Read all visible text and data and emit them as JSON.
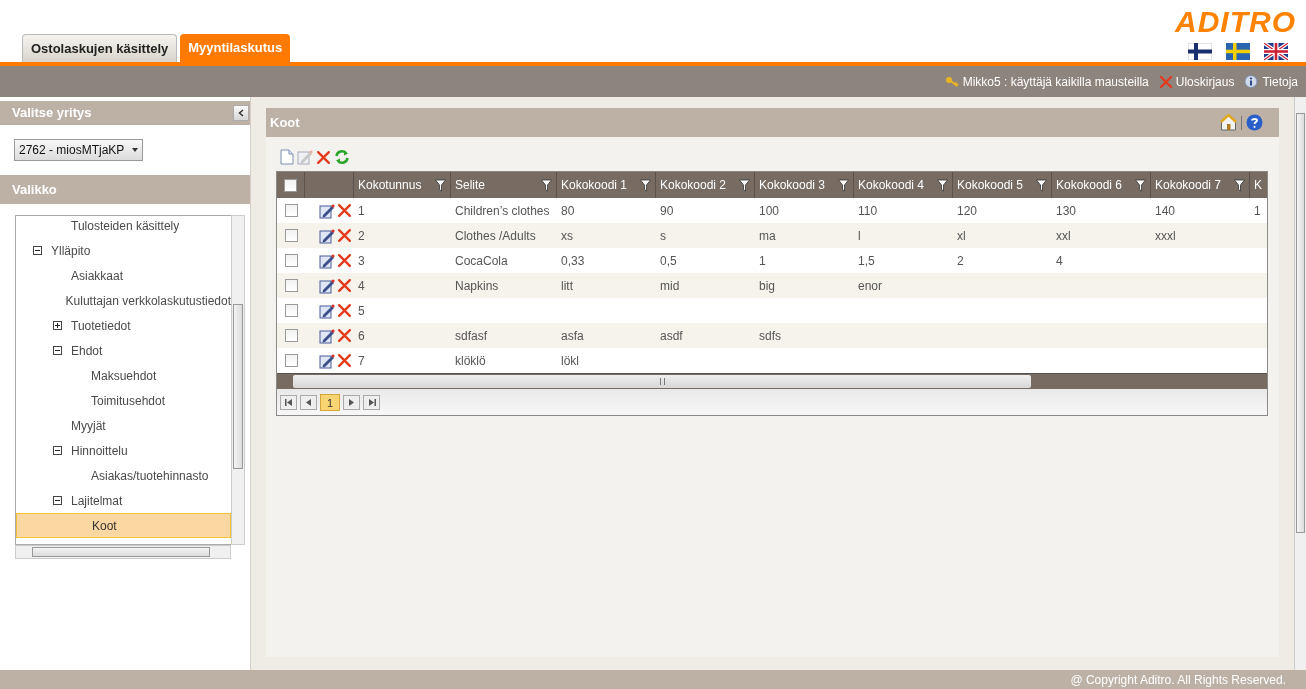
{
  "logo": "ADITRO",
  "tabs": [
    {
      "label": "Ostolaskujen käsittely",
      "selected": false
    },
    {
      "label": "Myyntilaskutus",
      "selected": true
    }
  ],
  "user_bar": {
    "user": "Mikko5 : käyttäjä kaikilla mausteilla",
    "logout": "Uloskirjaus",
    "info": "Tietoja"
  },
  "sidebar": {
    "company_title": "Valitse yritys",
    "company_select": {
      "value": "2762 - miosMTjaKP"
    },
    "menu_title": "Valikko",
    "tree": [
      {
        "children": [
          {
            "label": "Tulosteiden käsittely",
            "selected": false
          }
        ]
      },
      {
        "label": "Ylläpito",
        "expanded": true,
        "selected": false,
        "children": [
          {
            "label": "Asiakkaat",
            "selected": false
          },
          {
            "label": "Kuluttajan verkkolaskutustiedot",
            "selected": false
          },
          {
            "label": "Tuotetiedot",
            "expanded": false,
            "selected": false
          },
          {
            "label": "Ehdot",
            "expanded": true,
            "selected": false,
            "children": [
              {
                "label": "Maksuehdot",
                "selected": false
              },
              {
                "label": "Toimitusehdot",
                "selected": false
              }
            ]
          },
          {
            "label": "Myyjät",
            "selected": false
          },
          {
            "label": "Hinnoittelu",
            "expanded": true,
            "selected": false,
            "children": [
              {
                "label": "Asiakas/tuotehinnasto",
                "selected": false
              }
            ]
          },
          {
            "label": "Lajitelmat",
            "expanded": true,
            "selected": false,
            "children": [
              {
                "label": "Koot",
                "selected": true
              }
            ]
          }
        ]
      }
    ]
  },
  "panel": {
    "title": "Koot",
    "table": {
      "select_all_checked": false,
      "columns": [
        "Kokotunnus",
        "Selite",
        "Kokokoodi 1",
        "Kokokoodi 2",
        "Kokokoodi 3",
        "Kokokoodi 4",
        "Kokokoodi 5",
        "Kokokoodi 6",
        "Kokokoodi 7",
        "K"
      ],
      "rows": [
        {
          "checked": false,
          "cells": [
            "1",
            "Children’s clothes",
            "80",
            "90",
            "100",
            "110",
            "120",
            "130",
            "140",
            "1"
          ]
        },
        {
          "checked": false,
          "cells": [
            "2",
            "Clothes /Adults",
            "xs",
            "s",
            "ma",
            "l",
            "xl",
            "xxl",
            "xxxl",
            ""
          ]
        },
        {
          "checked": false,
          "cells": [
            "3",
            "CocaCola",
            "0,33",
            "0,5",
            "1",
            "1,5",
            "2",
            "4",
            "",
            ""
          ]
        },
        {
          "checked": false,
          "cells": [
            "4",
            "Napkins",
            "litt",
            "mid",
            "big",
            "enor",
            "",
            "",
            "",
            ""
          ]
        },
        {
          "checked": false,
          "cells": [
            "5",
            "",
            "",
            "",
            "",
            "",
            "",
            "",
            "",
            ""
          ]
        },
        {
          "checked": false,
          "cells": [
            "6",
            "sdfasf",
            "asfa",
            "asdf",
            "sdfs",
            "",
            "",
            "",
            "",
            ""
          ]
        },
        {
          "checked": false,
          "cells": [
            "7",
            "klöklö",
            "lökl",
            "",
            "",
            "",
            "",
            "",
            "",
            ""
          ]
        }
      ]
    },
    "pager": [
      {
        "label": "1",
        "selected": true
      }
    ]
  },
  "footer": "@ Copyright Aditro. All Rights Reserved."
}
